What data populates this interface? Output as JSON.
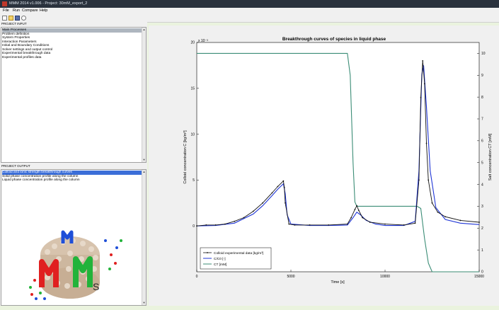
{
  "window": {
    "title": "MMM 2014 v1.006 - Project: 30mM_export_2"
  },
  "menu": [
    "File",
    "Run",
    "Compare",
    "Help"
  ],
  "toolbar": {
    "icons": [
      "new-file-icon",
      "open-folder-icon",
      "save-icon",
      "run-icon"
    ]
  },
  "project_input": {
    "title": "PROJECT INPUT",
    "items": [
      "Main Processes",
      "Problem definition",
      "System Properties",
      "Interaction Parameters",
      "Initial and Boundary Conditions",
      "Solver settings and output control",
      "Experimental breakthrough data",
      "Experimental profiles data"
    ],
    "selected_index": 0
  },
  "project_output": {
    "title": "PROJECT OUTPUT",
    "items": [
      "Colloid and ionic strength breakthrough curves",
      "Solid phase concentration profile along the column",
      "Liquid phase concentration profile along the column"
    ],
    "selected_index": 0
  },
  "logo": {
    "letters": [
      "M",
      "M",
      "M",
      "S"
    ],
    "colors": [
      "#e02020",
      "#1f4fd8",
      "#22b33a",
      "#222222"
    ]
  },
  "chart_data": {
    "type": "line",
    "title": "Breakthrough curves of species in liquid phase",
    "xlabel": "Time [s]",
    "ylabel_left": "Colloid concentration C [kg/m³]",
    "ylabel_right": "Salt concentration CT [mM]",
    "exponent_label": "x 10⁻³",
    "xlim": [
      0,
      15000
    ],
    "ylim_left": [
      -5,
      20
    ],
    "ylim_right": [
      0,
      10.5
    ],
    "x_ticks": [
      "0",
      "5000",
      "10000",
      "15000"
    ],
    "y_left_ticks": [
      "0",
      "5",
      "10",
      "15",
      "20"
    ],
    "y_right_ticks": [
      "0",
      "1",
      "2",
      "3",
      "4",
      "5",
      "6",
      "7",
      "8",
      "9",
      "10"
    ],
    "legend": {
      "placement": "bottom-left",
      "entries": [
        "Colloid experimental data [kg/m³]",
        "C/C0 [-]",
        "CT [mM]"
      ]
    },
    "series": [
      {
        "name": "Colloid experimental data [kg/m³]",
        "axis": "left",
        "color": "#111111",
        "marker": "dot",
        "x": [
          0,
          500,
          1000,
          1500,
          2000,
          2500,
          3000,
          3500,
          4000,
          4300,
          4600,
          4650,
          4700,
          4900,
          5200,
          6000,
          7000,
          8000,
          8200,
          8400,
          8500,
          8600,
          8800,
          9200,
          10000,
          11000,
          11600,
          11800,
          11900,
          12000,
          12100,
          12200,
          12300,
          12500,
          12800,
          13200,
          14000,
          15000
        ],
        "y": [
          0.0,
          0.1,
          0.1,
          0.2,
          0.5,
          0.9,
          1.6,
          2.5,
          3.6,
          4.3,
          4.9,
          4.2,
          2.5,
          0.2,
          0.1,
          0.1,
          0.1,
          0.2,
          0.9,
          1.8,
          2.2,
          1.7,
          0.9,
          0.4,
          0.2,
          0.1,
          0.3,
          5.0,
          14.0,
          18.0,
          15.5,
          9.0,
          5.0,
          2.5,
          1.5,
          1.0,
          0.6,
          0.4
        ]
      },
      {
        "name": "C/C0 [-]",
        "axis": "left",
        "color": "#1f35d6",
        "marker": "none",
        "x": [
          0,
          1000,
          2000,
          3000,
          3500,
          4000,
          4300,
          4600,
          4700,
          4800,
          5000,
          6000,
          7000,
          8000,
          8300,
          8500,
          8700,
          9000,
          9500,
          10000,
          11000,
          11600,
          11800,
          11950,
          12050,
          12200,
          12400,
          12700,
          13200,
          14000,
          15000
        ],
        "y": [
          0.0,
          0.05,
          0.3,
          1.3,
          2.2,
          3.3,
          4.0,
          4.6,
          3.5,
          1.2,
          0.2,
          0.05,
          0.05,
          0.1,
          0.9,
          1.5,
          1.2,
          0.6,
          0.2,
          0.05,
          0.05,
          0.5,
          6.0,
          16.5,
          17.5,
          13.0,
          6.0,
          2.0,
          0.7,
          0.3,
          0.15
        ]
      },
      {
        "name": "CT [mM]",
        "axis": "right",
        "color": "#3b8d76",
        "marker": "none",
        "x": [
          0,
          8000,
          8150,
          8300,
          8400,
          8500,
          11700,
          11900,
          12100,
          12300,
          12500,
          15000
        ],
        "y": [
          10.0,
          10.0,
          9.0,
          5.0,
          3.2,
          3.0,
          3.0,
          2.9,
          1.5,
          0.4,
          0.0,
          0.0
        ]
      }
    ]
  }
}
